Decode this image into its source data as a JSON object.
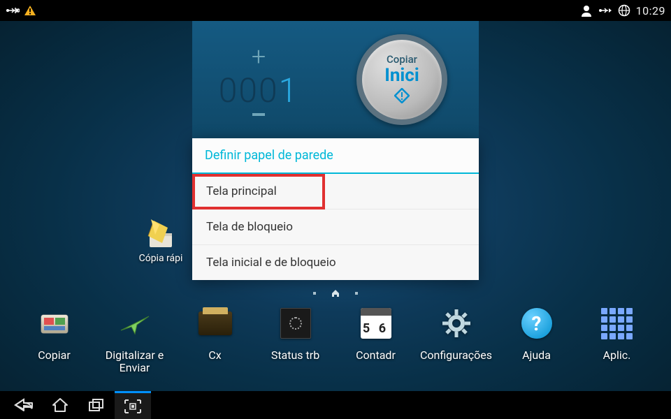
{
  "status": {
    "clock": "10:29"
  },
  "widget": {
    "counter_dim": "000",
    "counter_bright": "1",
    "btn_line1": "Copiar",
    "btn_line2": "Inici"
  },
  "dialog": {
    "title": "Definir papel de parede",
    "item_main": "Tela principal",
    "item_lock": "Tela de bloqueio",
    "item_both": "Tela inicial e de bloqueio"
  },
  "desktop": {
    "quick_copy_label": "Cópia rápi"
  },
  "dock": {
    "copy": "Copiar",
    "scan": "Digitalizar e Enviar",
    "box": "Cx",
    "status": "Status trb",
    "counter": "Contadr",
    "settings": "Configurações",
    "help": "Ajuda",
    "apps": "Aplic.",
    "calendar_num": "5 6"
  }
}
